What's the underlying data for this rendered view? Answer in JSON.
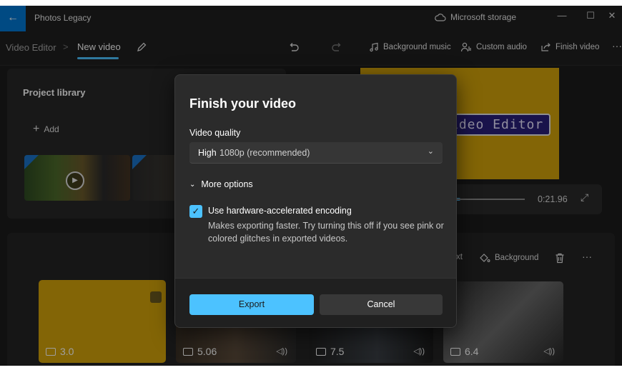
{
  "titlebar": {
    "app_name": "Photos Legacy",
    "back_icon": "←",
    "storage_label": "Microsoft storage",
    "minimize": "—",
    "maximize": "☐",
    "close": "✕"
  },
  "toolbar": {
    "crumb_root": "Video Editor",
    "crumb_sep": ">",
    "crumb_current": "New video",
    "background_music": "Background music",
    "custom_audio": "Custom audio",
    "finish_video": "Finish video",
    "more": "···"
  },
  "library": {
    "title": "Project library",
    "add_label": "Add"
  },
  "preview": {
    "title_text": "ideo Editor",
    "time": "0:21.96"
  },
  "storyboard": {
    "text_tool": "xt",
    "background_tool": "Background",
    "more": "···",
    "clips": [
      {
        "duration": "3.0"
      },
      {
        "duration": "5.06"
      },
      {
        "duration": "7.5"
      },
      {
        "duration": "6.4"
      }
    ]
  },
  "dialog": {
    "title": "Finish your video",
    "quality_label": "Video quality",
    "quality_strong": "High",
    "quality_rest": "1080p (recommended)",
    "more_options": "More options",
    "hw_label": "Use hardware-accelerated encoding",
    "hw_desc": "Makes exporting faster. Try turning this off if you see pink or colored glitches in exported videos.",
    "hw_checked": true,
    "export_label": "Export",
    "cancel_label": "Cancel"
  },
  "colors": {
    "accent": "#4cc2ff",
    "title_card": "#d4a30a"
  }
}
